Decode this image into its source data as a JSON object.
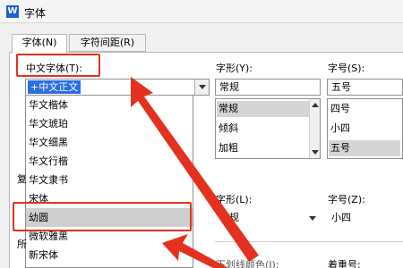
{
  "window": {
    "title": "字体",
    "icon_letter": "W"
  },
  "tabs": [
    {
      "label": "字体(N)",
      "active": true
    },
    {
      "label": "字符间距(R)",
      "active": false
    }
  ],
  "chinese_font": {
    "label": "中文字体(T):",
    "value": "+中文正文",
    "options": [
      "华文楷体",
      "华文琥珀",
      "华文细黑",
      "华文行楷",
      "华文隶书",
      "宋体",
      "幼圆",
      "微软雅黑",
      "新宋体"
    ],
    "highlighted": "幼圆"
  },
  "side_labels": {
    "complex": "复",
    "all": "所"
  },
  "style": {
    "label": "字形(Y):",
    "value": "常规",
    "options": [
      "常规",
      "倾斜",
      "加粗"
    ],
    "selected": "常规"
  },
  "size": {
    "label": "字号(S):",
    "value": "五号",
    "options": [
      "四号",
      "小四",
      "五号"
    ],
    "selected": "五号"
  },
  "complex_style": {
    "label": "字形(L):",
    "value": "常规"
  },
  "complex_size": {
    "label": "字号(Z):",
    "value": "小四"
  },
  "underline_color": {
    "label": "下划线颜色(I):"
  },
  "emphasis": {
    "label": "着重号:"
  },
  "colors": {
    "selection": "#2a6ee0",
    "highlight": "#cfcfcf",
    "annotation": "#e4311f"
  }
}
